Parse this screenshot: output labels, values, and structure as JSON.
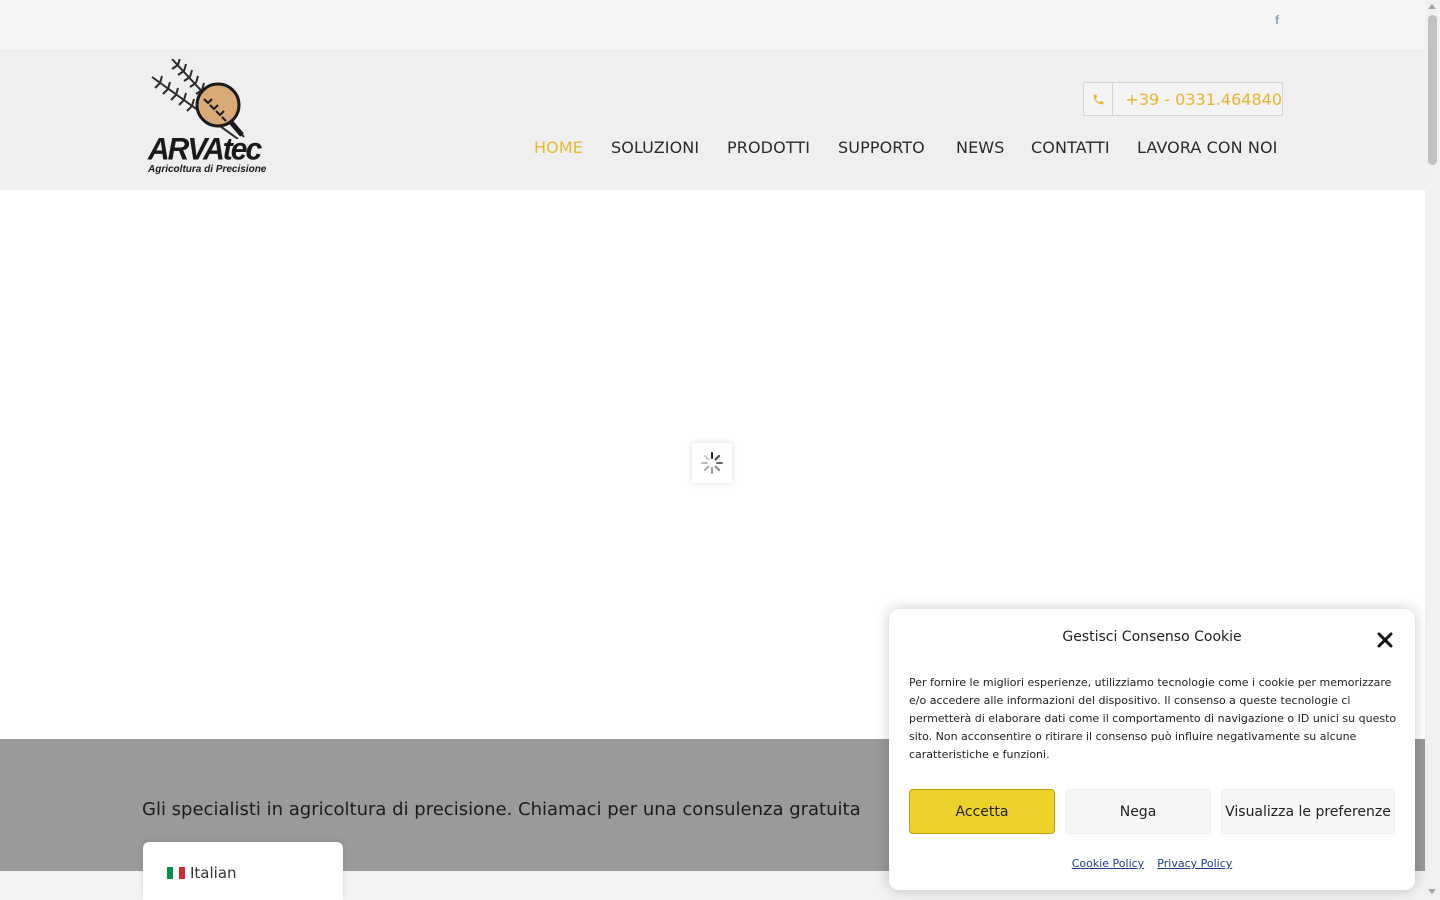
{
  "topbar": {
    "facebook_icon": "facebook-icon",
    "facebook_glyph": "f"
  },
  "header": {
    "logo": {
      "name": "ARVAtec",
      "tagline": "Agricoltura di Precisione"
    },
    "phone": {
      "icon": "phone-icon",
      "number": "+39 - 0331.464840"
    },
    "nav": [
      {
        "label": "HOME",
        "active": true
      },
      {
        "label": "SOLUZIONI",
        "active": false
      },
      {
        "label": "PRODOTTI",
        "active": false
      },
      {
        "label": "SUPPORTO",
        "active": false
      },
      {
        "label": "NEWS",
        "active": false
      },
      {
        "label": "CONTATTI",
        "active": false
      },
      {
        "label": "LAVORA CON NOI",
        "active": false
      }
    ]
  },
  "slider": {
    "state": "loading",
    "loader_icon": "spinner-icon"
  },
  "band": {
    "text": "Gli specialisti in agricoltura di precisione. Chiamaci per una consulenza gratuita"
  },
  "language_switcher": {
    "flag": "italy-flag-icon",
    "label": "Italian"
  },
  "cookie_banner": {
    "title": "Gestisci Consenso Cookie",
    "body": "Per fornire le migliori esperienze, utilizziamo tecnologie come i cookie per memorizzare e/o accedere alle informazioni del dispositivo. Il consenso a queste tecnologie ci permetterà di elaborare dati come il comportamento di navigazione o ID unici su questo sito. Non acconsentire o ritirare il consenso può influire negativamente su alcune caratteristiche e funzioni.",
    "accept_label": "Accetta",
    "deny_label": "Nega",
    "preferences_label": "Visualizza le preferenze",
    "cookie_policy_label": "Cookie Policy",
    "privacy_policy_label": "Privacy Policy",
    "close_icon": "close-icon"
  },
  "colors": {
    "accent": "#e9b92c",
    "accept_button": "#ecd22a",
    "band_bg": "#9a9a9a",
    "header_bg": "#efefef",
    "topbar_bg": "#f5f5f5",
    "link": "#1e3e88"
  }
}
